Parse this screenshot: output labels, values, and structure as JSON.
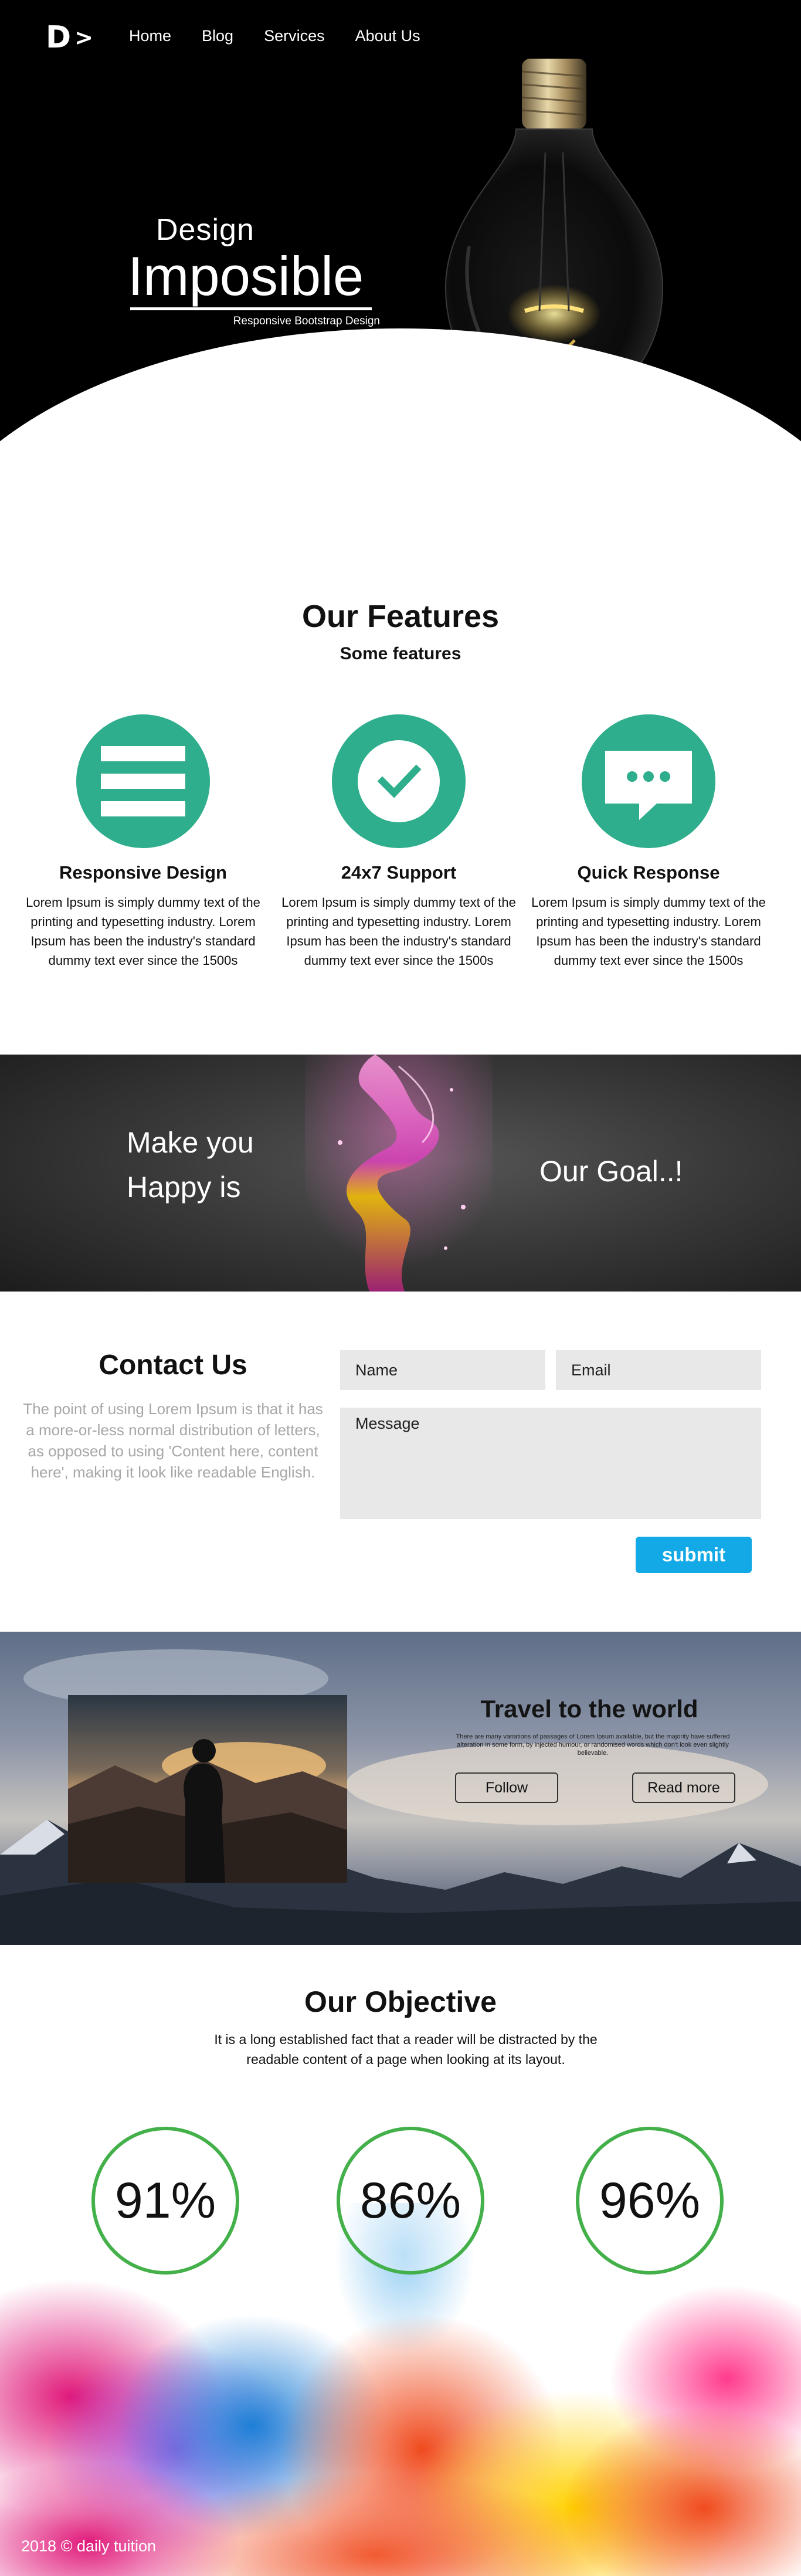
{
  "nav": {
    "logo": "D",
    "links": [
      "Home",
      "Blog",
      "Services",
      "About Us"
    ]
  },
  "hero": {
    "line1": "Design",
    "line2": "Imposible",
    "tagline": "Responsive Bootstrap Design"
  },
  "features": {
    "title": "Our Features",
    "subtitle": "Some features",
    "items": [
      {
        "icon": "menu-icon",
        "title": "Responsive Design",
        "text": "Lorem Ipsum is simply dummy text of the printing and typesetting industry. Lorem Ipsum has been the industry's standard dummy text ever since the 1500s"
      },
      {
        "icon": "check-circle-icon",
        "title": "24x7 Support",
        "text": "Lorem Ipsum is simply dummy text of the printing and typesetting industry. Lorem Ipsum has been the industry's standard dummy text ever since the 1500s"
      },
      {
        "icon": "chat-bubble-icon",
        "title": "Quick Response",
        "text": "Lorem Ipsum is simply dummy text of the printing and typesetting industry. Lorem Ipsum has been the industry's standard dummy text ever since the 1500s"
      }
    ],
    "accent": "#2eae8c"
  },
  "goal": {
    "line1": "Make you",
    "line2": "Happy is",
    "right": "Our Goal..!"
  },
  "contact": {
    "title": "Contact Us",
    "text": "The point of using Lorem Ipsum is that it has a more-or-less normal distribution of letters, as opposed to using 'Content here, content here', making it look like readable English.",
    "name_placeholder": "Name",
    "email_placeholder": "Email",
    "message_placeholder": "Message",
    "submit_label": "submit",
    "submit_color": "#12a9e6"
  },
  "travel": {
    "title": "Travel to the world",
    "text": "There are many variations of passages of Lorem Ipsum available, but the majority have suffered alteration in some form, by injected humour, or randomised words which don't look even slightly believable.",
    "follow_label": "Follow",
    "read_more_label": "Read more"
  },
  "objective": {
    "title": "Our Objective",
    "text": "It is a long established fact that a reader will be distracted by the readable content of a page when looking at its layout.",
    "stats": [
      "91%",
      "86%",
      "96%"
    ],
    "ring_color": "#43b04a"
  },
  "footer": {
    "text": "2018 © daily tuition"
  }
}
